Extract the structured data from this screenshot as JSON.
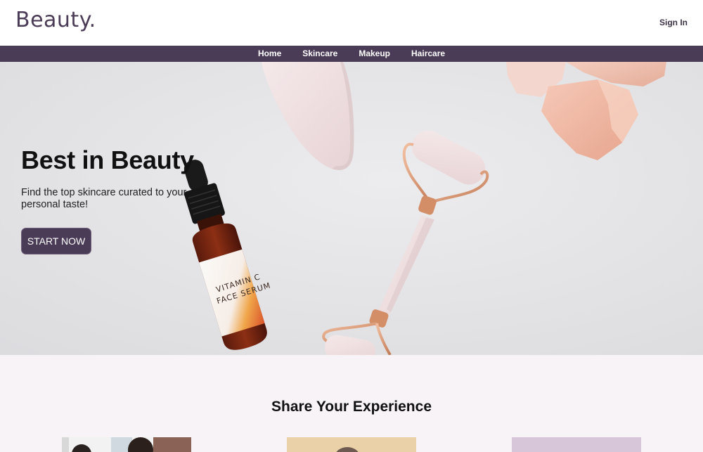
{
  "header": {
    "logo": "Beauty.",
    "sign_in": "Sign In"
  },
  "nav": {
    "items": [
      {
        "label": "Home"
      },
      {
        "label": "Skincare"
      },
      {
        "label": "Makeup"
      },
      {
        "label": "Haircare"
      }
    ]
  },
  "hero": {
    "title": "Best in Beauty",
    "subtitle": "Find the top skincare curated to your personal taste!",
    "cta": "START NOW",
    "bottle_label_line1": "VITAMIN C",
    "bottle_label_line2": "FACE SERUM"
  },
  "experience": {
    "title": "Share Your Experience"
  },
  "colors": {
    "brand": "#4a3b56",
    "hero_bg": "#e4e4e6",
    "section_bg": "#f7f3f7"
  }
}
